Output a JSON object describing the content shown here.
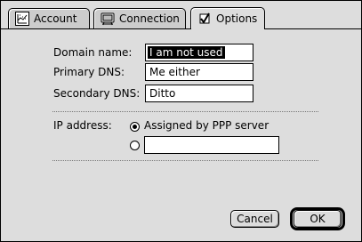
{
  "tabs": [
    {
      "label": "Account",
      "icon": "account-icon"
    },
    {
      "label": "Connection",
      "icon": "connection-icon"
    },
    {
      "label": "Options",
      "icon": "checkbox-icon",
      "active": true
    }
  ],
  "form": {
    "domain_label": "Domain name:",
    "domain_value": "I am not used",
    "primary_label": "Primary DNS:",
    "primary_value": "Me either",
    "secondary_label": "Secondary DNS:",
    "secondary_value": "Ditto",
    "ip_label": "IP address:",
    "ip_option_assigned": "Assigned by PPP server",
    "ip_manual_value": ""
  },
  "buttons": {
    "cancel": "Cancel",
    "ok": "OK"
  },
  "colors": {
    "window_bg": "#dddddd",
    "selection_bg": "#000000",
    "selection_fg": "#ffffff"
  }
}
